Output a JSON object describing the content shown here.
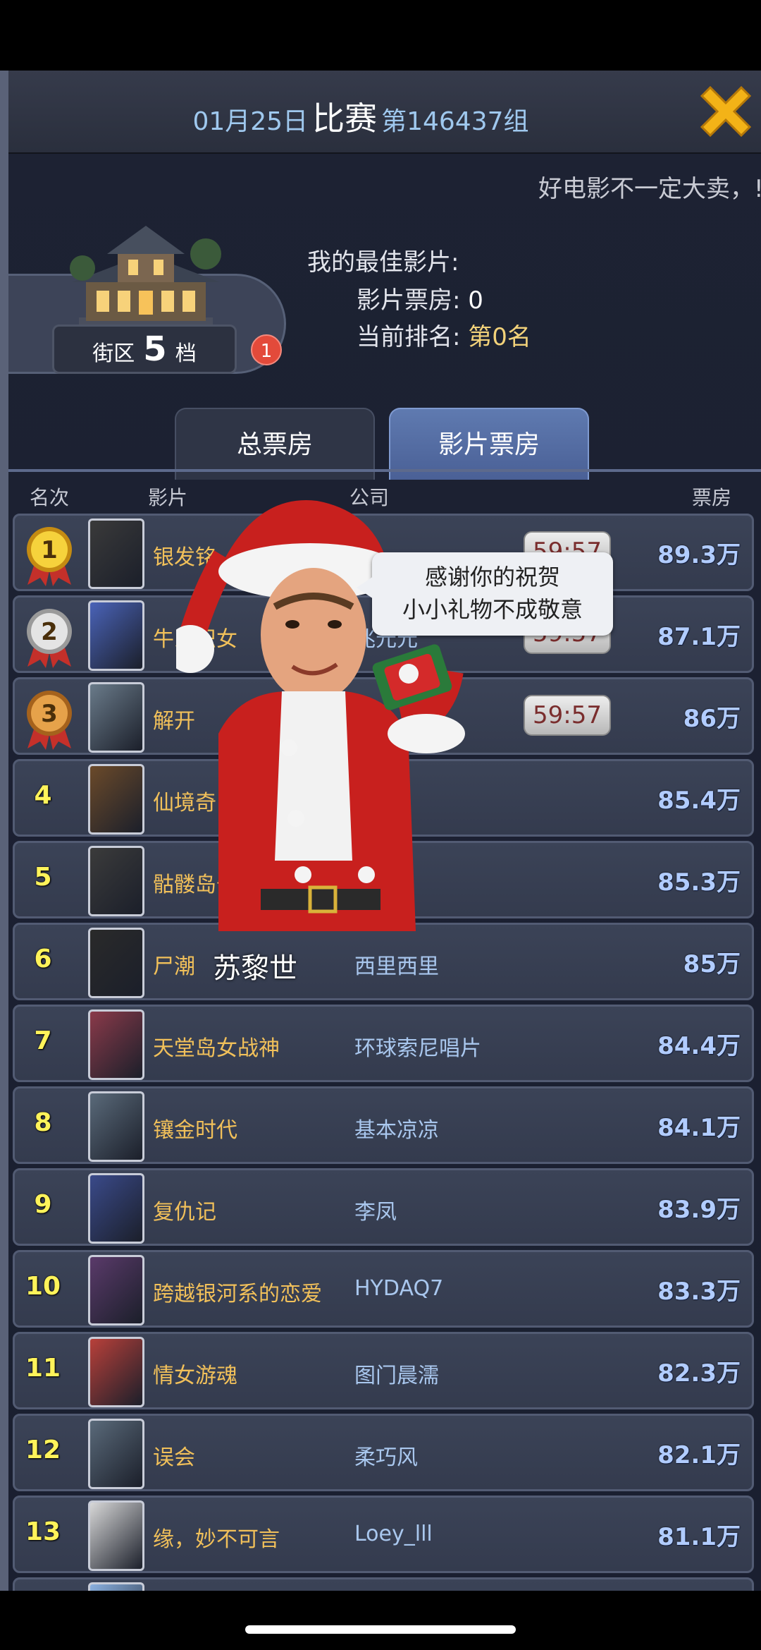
{
  "header": {
    "date": "01月25日",
    "event": "比赛",
    "group": "第146437组",
    "close_icon": "close-x-icon"
  },
  "marquee": "好电影不一定大卖，!",
  "district": {
    "prefix": "街区",
    "level": "5",
    "suffix": "档",
    "badge": "1"
  },
  "best_movie": {
    "label": "我的最佳影片:",
    "box_office_label": "影片票房:",
    "box_office_value": "0",
    "rank_label": "当前排名:",
    "rank_value": "第0名"
  },
  "tabs": [
    {
      "label": "总票房",
      "active": false
    },
    {
      "label": "影片票房",
      "active": true
    }
  ],
  "columns": {
    "rank": "名次",
    "movie": "影片",
    "company": "公司",
    "box_office": "票房"
  },
  "rows": [
    {
      "rank": "1",
      "title": "银发铭",
      "company": "",
      "timer": "59:57",
      "box_office": "89.3万"
    },
    {
      "rank": "2",
      "title": "牛郎织女",
      "company": "兆元元",
      "timer": "59:57",
      "box_office": "87.1万"
    },
    {
      "rank": "3",
      "title": "解开",
      "company": "",
      "timer": "59:57",
      "box_office": "86万"
    },
    {
      "rank": "4",
      "title": "仙境奇",
      "company": "",
      "timer": "",
      "box_office": "85.4万"
    },
    {
      "rank": "5",
      "title": "骷髅岛奇",
      "company": "",
      "timer": "",
      "box_office": "85.3万"
    },
    {
      "rank": "6",
      "title": "尸潮",
      "company": "西里西里",
      "timer": "",
      "box_office": "85万"
    },
    {
      "rank": "7",
      "title": "天堂岛女战神",
      "company": "环球索尼唱片",
      "timer": "",
      "box_office": "84.4万"
    },
    {
      "rank": "8",
      "title": "镶金时代",
      "company": "基本凉凉",
      "timer": "",
      "box_office": "84.1万"
    },
    {
      "rank": "9",
      "title": "复仇记",
      "company": "李凤",
      "timer": "",
      "box_office": "83.9万"
    },
    {
      "rank": "10",
      "title": "跨越银河系的恋爱",
      "company": "HYDAQ7",
      "timer": "",
      "box_office": "83.3万"
    },
    {
      "rank": "11",
      "title": "情女游魂",
      "company": "图门晨濡",
      "timer": "",
      "box_office": "82.3万"
    },
    {
      "rank": "12",
      "title": "误会",
      "company": "柔巧风",
      "timer": "",
      "box_office": "82.1万"
    },
    {
      "rank": "13",
      "title": "缘，妙不可言",
      "company": "Loey_lll",
      "timer": "",
      "box_office": "81.1万"
    }
  ],
  "popup": {
    "line1": "感谢你的祝贺",
    "line2": "小小礼物不成敬意",
    "name": "苏黎世"
  }
}
